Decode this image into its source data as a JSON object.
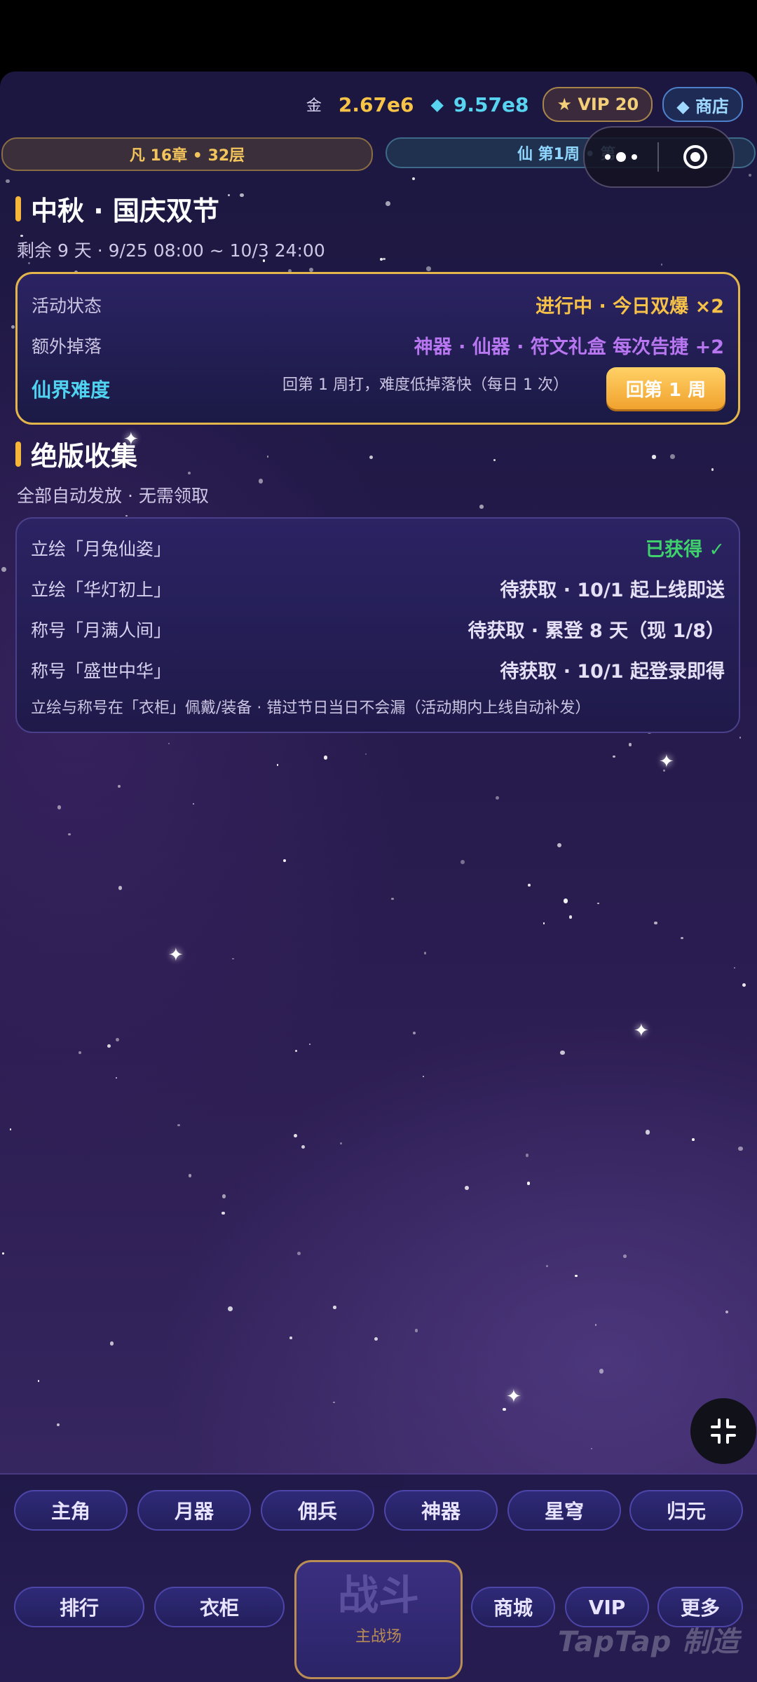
{
  "currency": {
    "gold_label": "金",
    "gold_value": "2.67e6",
    "diamond_value": "9.57e8",
    "vip_label": "★ VIP 20",
    "shop_label": "◆ 商店"
  },
  "progress": {
    "left": "凡 16章 • 32层",
    "right": "仙 第1周 • 第"
  },
  "event": {
    "title": "中秋 · 国庆双节",
    "subtitle": "剩余 9 天 · 9/25 08:00 ~ 10/3 24:00",
    "status_label": "活动状态",
    "status_value": "进行中 · 今日双爆 ×2",
    "drop_label": "额外掉落",
    "drop_value": "神器 · 仙器 · 符文礼盒 每次告捷 +2",
    "difficulty_label": "仙界难度",
    "difficulty_hint": "回第 1 周打，难度低掉落快（每日 1 次）",
    "return_button": "回第 1 周"
  },
  "collection": {
    "title": "绝版收集",
    "subtitle": "全部自动发放 · 无需领取",
    "items": [
      {
        "label": "立绘「月兔仙姿」",
        "status": "已获得 ✓"
      },
      {
        "label": "立绘「华灯初上」",
        "status": "待获取 · 10/1 起上线即送"
      },
      {
        "label": "称号「月满人间」",
        "status": "待获取 · 累登 8 天（现 1/8）"
      },
      {
        "label": "称号「盛世中华」",
        "status": "待获取 · 10/1 起登录即得"
      }
    ],
    "note": "立绘与称号在「衣柜」佩戴/装备 · 错过节日当日不会漏（活动期内上线自动补发）"
  },
  "nav": {
    "row1": [
      "主角",
      "月器",
      "佣兵",
      "神器",
      "星穹",
      "归元"
    ],
    "row2_left": [
      "排行",
      "衣柜"
    ],
    "fight": "战斗",
    "fight_sub": "主战场",
    "row2_right": [
      "商城",
      "VIP",
      "更多"
    ]
  },
  "watermark": "TapTap 制造",
  "colors": {
    "gold": "#f6c148",
    "cyan": "#4fd3f0",
    "purple": "#b877f0",
    "green": "#3fd16c",
    "card_border": "#e3b64c"
  }
}
